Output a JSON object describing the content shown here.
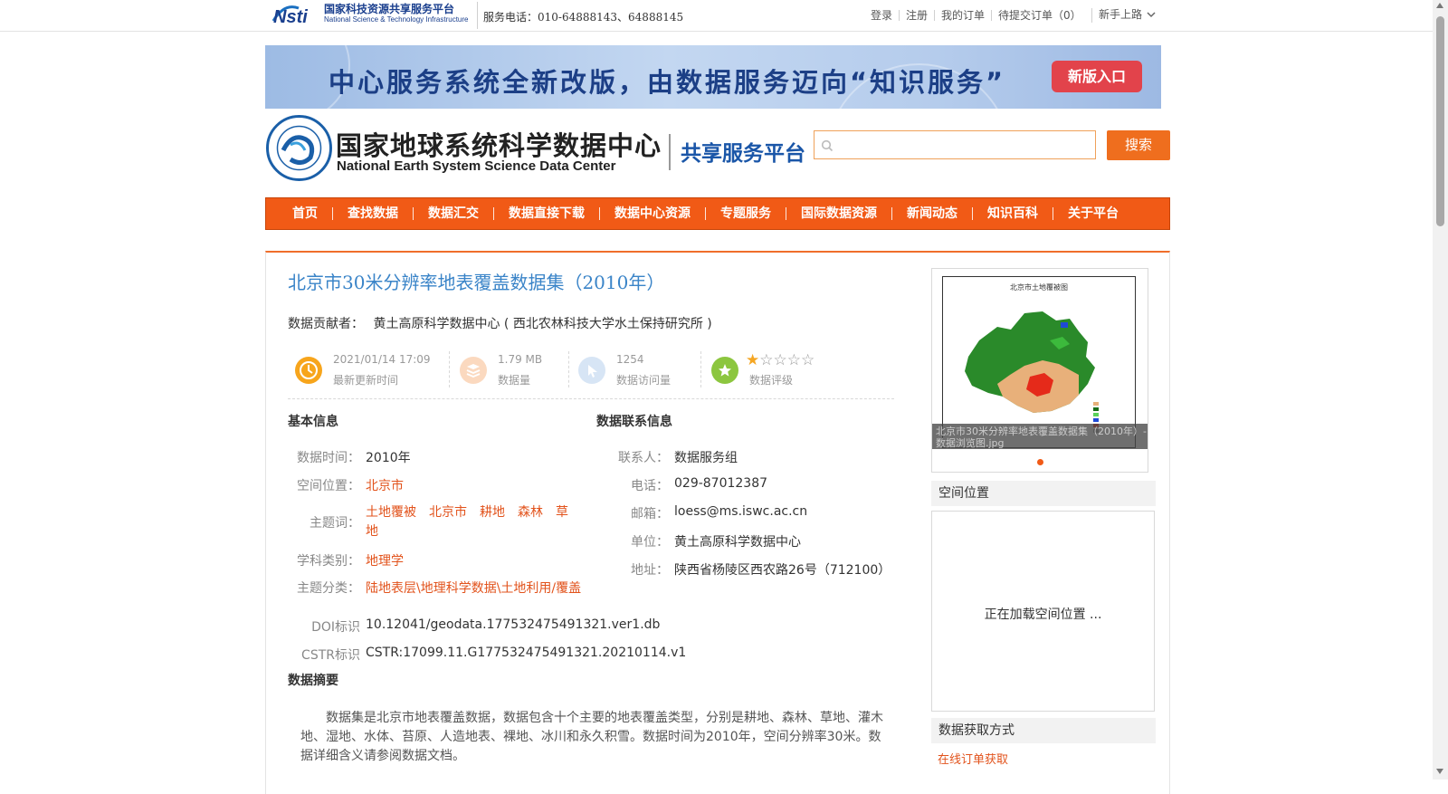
{
  "topbar": {
    "logo_cn": "国家科技资源共享服务平台",
    "logo_en": "National Science & Technology Infrastructure",
    "hotline": "服务电话：010-64888143、64888145",
    "links": [
      "登录",
      "注册",
      "我的订单",
      "待提交订单（0）"
    ],
    "newbie": "新手上路"
  },
  "banner": {
    "text": "中心服务系统全新改版，由数据服务迈向“知识服务”",
    "button": "新版入口"
  },
  "header": {
    "name_cn": "国家地球系统科学数据中心",
    "name_en": "National Earth System Science Data Center",
    "platform": "共享服务平台",
    "search_placeholder": "",
    "search_button": "搜索"
  },
  "nav": [
    "首页",
    "查找数据",
    "数据汇交",
    "数据直接下载",
    "数据中心资源",
    "专题服务",
    "国际数据资源",
    "新闻动态",
    "知识百科",
    "关于平台"
  ],
  "dataset": {
    "title": "北京市30米分辨率地表覆盖数据集（2010年）",
    "contributor_label": "数据贡献者：",
    "contributor": "黄土高原科学数据中心 ( 西北农林科技大学水土保持研究所 )",
    "stats": [
      {
        "value": "2021/01/14 17:09",
        "label": "最新更新时间"
      },
      {
        "value": "1.79 MB",
        "label": "数据量"
      },
      {
        "value": "1254",
        "label": "数据访问量"
      }
    ],
    "rating_label": "数据评级",
    "rating": 1,
    "rating_max": 5
  },
  "basic": {
    "title": "基本信息",
    "time_label": "数据时间：",
    "time": "2010年",
    "location_label": "空间位置：",
    "location": "北京市",
    "keywords_label": "主题词：",
    "keywords": [
      "土地覆被",
      "北京市",
      "耕地",
      "森林",
      "草地"
    ],
    "discipline_label": "学科类别：",
    "discipline": "地理学",
    "category_label": "主题分类：",
    "category": "陆地表层\\地理科学数据\\土地利用/覆盖",
    "doi_label": "DOI标识",
    "doi": "10.12041/geodata.177532475491321.ver1.db",
    "cstr_label": "CSTR标识",
    "cstr": "CSTR:17099.11.G177532475491321.20210114.v1"
  },
  "contact": {
    "title": "数据联系信息",
    "person_label": "联系人：",
    "person": "数据服务组",
    "phone_label": "电话：",
    "phone": "029-87012387",
    "email_label": "邮箱：",
    "email": "loess@ms.iswc.ac.cn",
    "org_label": "单位：",
    "org": "黄土高原科学数据中心",
    "address_label": "地址：",
    "address": "陕西省杨陵区西农路26号（712100）"
  },
  "abstract": {
    "title": "数据摘要",
    "text": "数据集是北京市地表覆盖数据，数据包含十个主要的地表覆盖类型，分别是耕地、森林、草地、灌木地、湿地、水体、苔原、人造地表、裸地、冰川和永久积雪。数据时间为2010年，空间分辨率30米。数据详细含义请参阅数据文档。"
  },
  "sidebar": {
    "thumb_caption": "北京市30米分辨率地表覆盖数据集（2010年）-数据浏览图.jpg",
    "map_title": "北京市土地覆被图",
    "location_title": "空间位置",
    "location_loading": "正在加载空间位置 ...",
    "access_title": "数据获取方式",
    "access_link": "在线订单获取"
  },
  "colors": {
    "accent": "#f15a16",
    "link": "#e2531c",
    "title_blue": "#3a84c8"
  }
}
